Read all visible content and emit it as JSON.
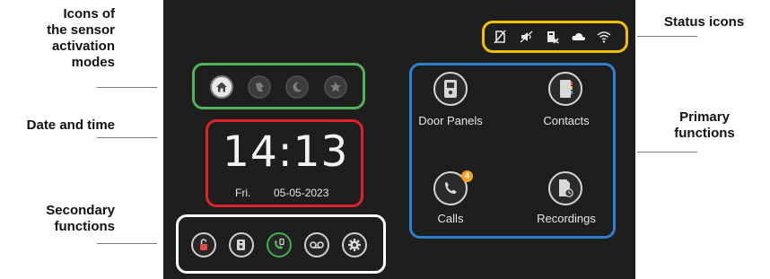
{
  "annotations": {
    "sensor_modes": [
      "Icons of",
      "the sensor",
      "activation",
      "modes"
    ],
    "date_time": "Date and time",
    "secondary": [
      "Secondary",
      "functions"
    ],
    "status": "Status icons",
    "primary": [
      "Primary",
      "functions"
    ]
  },
  "status_icons": [
    "sim-off-icon",
    "speaker-muted-icon",
    "dnd-door-icon",
    "cloud-icon",
    "wifi-icon"
  ],
  "modes": [
    {
      "icon": "home-icon",
      "active": true
    },
    {
      "icon": "away-icon",
      "active": false
    },
    {
      "icon": "night-icon",
      "active": false
    },
    {
      "icon": "custom-star-icon",
      "active": false
    }
  ],
  "clock": {
    "time": "14:13",
    "day": "Fri.",
    "date": "05-05-2023"
  },
  "secondary": [
    "unlock-icon",
    "intercom-icon",
    "monitor-call-icon",
    "voicemail-icon",
    "settings-gear-icon"
  ],
  "primary": {
    "door_panels": {
      "label": "Door Panels",
      "icon": "door-panel-icon"
    },
    "contacts": {
      "label": "Contacts",
      "icon": "contacts-book-icon"
    },
    "calls": {
      "label": "Calls",
      "icon": "phone-icon",
      "badge": "4"
    },
    "recordings": {
      "label": "Recordings",
      "icon": "recordings-icon"
    }
  },
  "colors": {
    "screen_bg": "#1e1e1e",
    "status_box": "#f2c200",
    "modes_box": "#52b35a",
    "date_box": "#e0212a",
    "secondary_box": "#ffffff",
    "primary_box": "#2f7fd0",
    "badge": "#f3a321"
  }
}
